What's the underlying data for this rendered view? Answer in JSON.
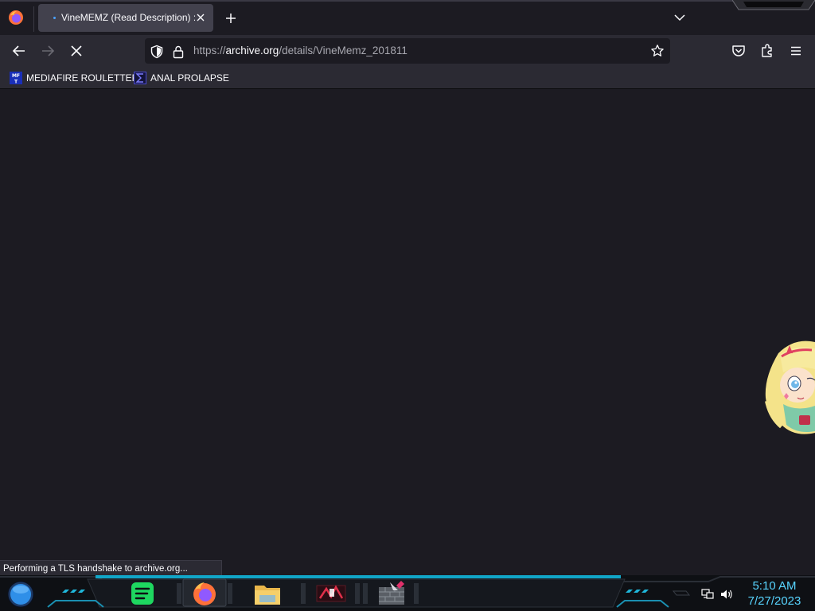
{
  "browser": {
    "tab": {
      "title": "VineMEMZ (Read Description) :"
    },
    "url": {
      "scheme": "https://",
      "host": "archive.org",
      "path": "/details/VineMemz_201811"
    },
    "bookmarks": [
      {
        "label": "MEDIAFIRE ROULETTER",
        "icon": "mft-favicon"
      },
      {
        "label": "ANAL PROLAPSE",
        "icon": "sigma-favicon"
      }
    ],
    "status": "Performing a TLS handshake to archive.org...",
    "loading": true
  },
  "taskbar": {
    "apps": [
      "spotify",
      "firefox",
      "file-explorer",
      "media-app",
      "games-app"
    ],
    "clock": {
      "time": "5:10 AM",
      "date": "7/27/2023"
    }
  },
  "colors": {
    "accent": "#58d4ff",
    "chrome": "#2b2a33",
    "page": "#1c1b22"
  }
}
